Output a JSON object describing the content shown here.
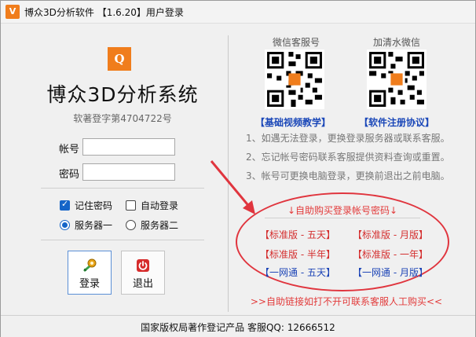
{
  "window": {
    "title": "博众3D分析软件 【1.6.20】用户登录",
    "icon": "app-logo-icon",
    "accent": "#f07d1c"
  },
  "login": {
    "logo_text": "Q",
    "system_title": "博众3D分析系统",
    "copyright": "软著登字第4704722号",
    "account_label": "帐号",
    "account_value": "",
    "password_label": "密码",
    "password_value": "",
    "remember_label": "记住密码",
    "remember_checked": true,
    "autologin_label": "自动登录",
    "autologin_checked": false,
    "server1_label": "服务器一",
    "server2_label": "服务器二",
    "server_selected": 1,
    "login_button": "登录",
    "exit_button": "退出"
  },
  "right": {
    "wechat_service_label": "微信客服号",
    "add_wechat_label": "加清水微信",
    "tutorial_link": "【基础视频教学】",
    "agreement_link": "【软件注册协议】",
    "notes": [
      "1、如遇无法登录，更换登录服务器或联系客服。",
      "2、忘记帐号密码联系客服提供资料查询或重置。",
      "3、帐号可更换电脑登录，更换前退出之前电脑。"
    ],
    "buy_title": "↓自助购买登录帐号密码↓",
    "buy_options": [
      "【标准版 - 五天】",
      "【标准版 - 月版】",
      "【标准版 - 半年】",
      "【标准版 - 一年】",
      "【一网通 - 五天】",
      "【一网通 - 月版】"
    ],
    "bottom_notice": ">>自助链接如打不开可联系客服人工购买<<"
  },
  "status": {
    "text": "国家版权局著作登记产品  客服QQ: 12666512"
  },
  "colors": {
    "red": "#e23b3b",
    "blue": "#1c44b6",
    "checkbox_blue": "#1565c8"
  }
}
